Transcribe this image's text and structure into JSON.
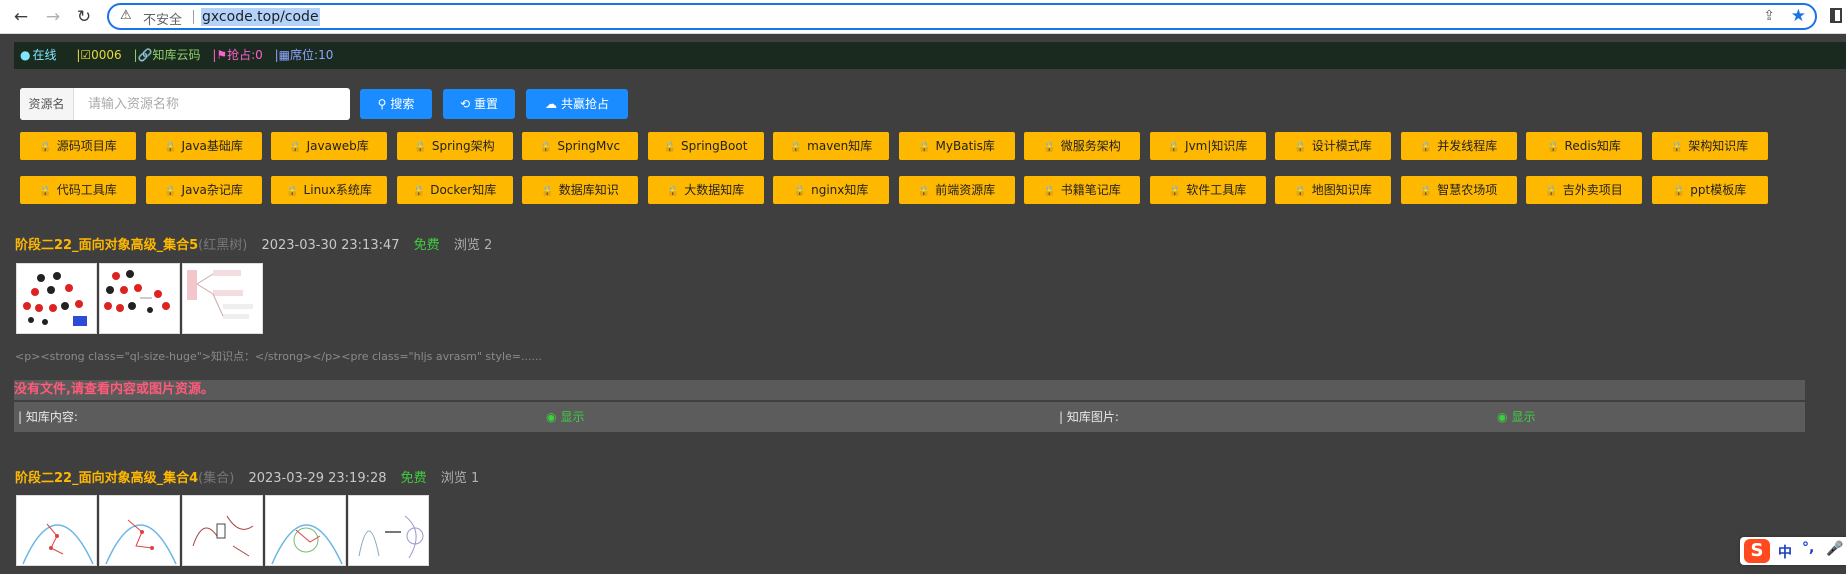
{
  "browser": {
    "insecure_label": "不安全",
    "url": "gxcode.top/code"
  },
  "status": {
    "online": "在线",
    "code": "|☑0006",
    "lib": "|🔗知库云码",
    "grab": "|⚑抢占:0",
    "seat": "|▦席位:10"
  },
  "search": {
    "label": "资源名",
    "placeholder": "请输入资源名称",
    "search_button": "搜索",
    "reset_button": "重置",
    "share_button": "共赢抢占"
  },
  "categories_row1": [
    "源码项目库",
    "Java基础库",
    "Javaweb库",
    "Spring架构",
    "SpringMvc",
    "SpringBoot",
    "maven知库",
    "MyBatis库",
    "微服务架构",
    "Jvm|知识库",
    "设计模式库",
    "并发线程库",
    "Redis知库",
    "架构知识库"
  ],
  "categories_row2": [
    "代码工具库",
    "Java杂记库",
    "Linux系统库",
    "Docker知库",
    "数据库知识",
    "大数据知库",
    "nginx知库",
    "前端资源库",
    "书籍笔记库",
    "软件工具库",
    "地图知识库",
    "智慧农场项",
    "吉外卖项目",
    "ppt模板库"
  ],
  "posts": [
    {
      "title": "阶段二22_面向对象高级_集合5",
      "tag": "(红黑树)",
      "date": "2023-03-30 23:13:47",
      "price": "免费",
      "views": "浏览 2",
      "excerpt": "<p><strong class=\"ql-size-huge\">知识点：</strong></p><pre class=\"hljs avrasm\" style=......",
      "no_file": "没有文件,请查看内容或图片资源。",
      "content_label": "| 知库内容:",
      "content_show": "显示",
      "image_label": "| 知库图片:",
      "image_show": "显示"
    },
    {
      "title": "阶段二22_面向对象高级_集合4",
      "tag": "(集合)",
      "date": "2023-03-29 23:19:28",
      "price": "免费",
      "views": "浏览 1"
    }
  ],
  "ime": {
    "logo": "S",
    "lang": "中",
    "punct": "°,",
    "mic": "🎤"
  }
}
